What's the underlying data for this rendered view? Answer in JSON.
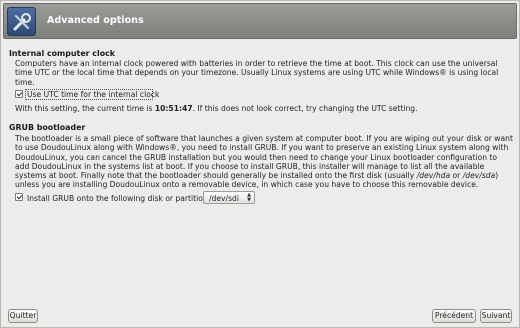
{
  "header": {
    "title": "Advanced options",
    "icon": "tools-icon"
  },
  "clock": {
    "title": "Internal computer clock",
    "description": "Computers have an internal clock powered with batteries in order to retrieve the time at boot. This clock can use the universal time UTC or the local time that depends on your timezone. Usually Linux systems are using UTC while Windows® is using local time.",
    "utc_checkbox_label": "Use UTC time for the internal clock",
    "utc_checked": true,
    "status_prefix": "With this setting, the current time is ",
    "current_time": "10:51:47",
    "status_suffix": ". If this does not look correct, try changing the UTC setting."
  },
  "grub": {
    "title": "GRUB bootloader",
    "description_part1": "The bootloader is a small piece of software that launches a given system at computer boot. If you are wiping out your disk or want to use DoudouLinux along with Windows®, you need to install GRUB. If you want to preserve an existing Linux system along with DoudouLinux, you can cancel the GRUB installation but you would then need to change your Linux bootloader configuration to add DoudouLinux in the systems list at boot. If you choose to install GRUB, this installer will manage to list all the available systems at boot. Finally note that the bootloader should generally be installed onto the first disk (usually ",
    "disk_example_1": "/dev/hda",
    "description_or": " or ",
    "disk_example_2": "/dev/sda",
    "description_part2": ") unless you are installing DoudouLinux onto a removable device, in which case you have to choose this removable device.",
    "install_checkbox_label": "Install GRUB onto the following disk or partition:",
    "install_checked": true,
    "disk_selected": "/dev/sdi"
  },
  "footer": {
    "quit_label": "Quitter",
    "previous_label": "Précédent",
    "next_label": "Suivant"
  }
}
